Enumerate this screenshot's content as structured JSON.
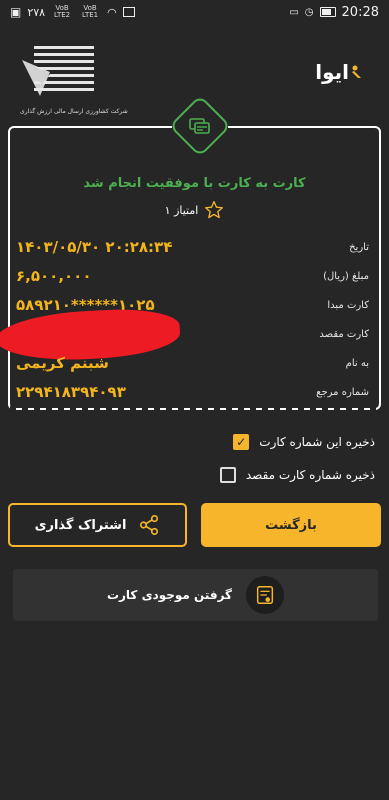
{
  "status_bar": {
    "left_text": "۲۷۸",
    "signal1": "VoB LTE2",
    "signal2": "VoB LTE1",
    "time": "20:28"
  },
  "header": {
    "bank_text": "شرکت کشاورزی ارسال مالی ارزش گذاری",
    "app_name": "ایوا"
  },
  "receipt": {
    "title": "کارت به کارت با موفقیت انجام شد",
    "points": "۱ امتیاز",
    "rows": [
      {
        "label": "تاریخ",
        "value": "۱۴۰۳/۰۵/۳۰ ۲۰:۲۸:۳۴"
      },
      {
        "label": "مبلغ (ریال)",
        "value": "۶,۵۰۰,۰۰۰"
      },
      {
        "label": "کارت مبدا",
        "value": "۵۸۹۲۱۰******۱۰۲۵"
      },
      {
        "label": "کارت مقصد",
        "value": ""
      },
      {
        "label": "به نام",
        "value": "شبنم کریمی"
      },
      {
        "label": "شماره مرجع",
        "value": "۲۲۹۴۱۸۳۹۴۰۹۳"
      }
    ]
  },
  "options": {
    "save_card": "ذخیره این شماره کارت",
    "save_dest": "ذخیره شماره کارت مقصد"
  },
  "buttons": {
    "back": "بازگشت",
    "share": "اشتراک گذاری",
    "balance": "گرفتن موجودی کارت"
  },
  "colors": {
    "accent": "#f7b52b",
    "success": "#4caf50",
    "background": "#262626"
  }
}
